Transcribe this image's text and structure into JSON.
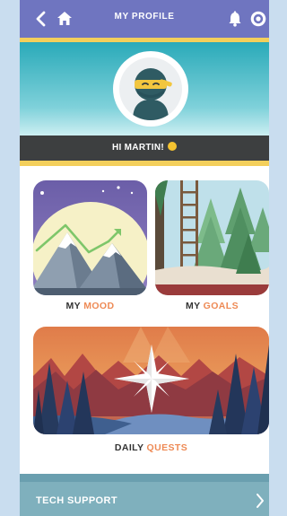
{
  "header": {
    "title": "MY PROFILE",
    "icons": [
      "back-chevron-icon",
      "home-icon",
      "alarm-bell-icon",
      "settings-gear-icon"
    ]
  },
  "profile": {
    "greeting": "HI MARTIN!",
    "greeting_emoji": "smiley-icon",
    "avatar": "ninja-avatar"
  },
  "tiles": [
    {
      "label_prefix": "MY ",
      "label_accent": "MOOD",
      "image": "mountains-illustration"
    },
    {
      "label_prefix": "MY ",
      "label_accent": "GOALS",
      "image": "forest-ladder-illustration"
    },
    {
      "label_prefix": "DAILY ",
      "label_accent": "QUESTS",
      "image": "compass-forest-illustration"
    }
  ],
  "footer": {
    "tech_support_label": "TECH SUPPORT",
    "chevron": "chevron-right-icon"
  },
  "colors": {
    "header_bg": "#6f75c0",
    "accent_yellow": "#f3cf5b",
    "label_accent": "#ee8a55",
    "greet_bg": "#3d3f40",
    "footer_bg": "#7fb0bd"
  }
}
